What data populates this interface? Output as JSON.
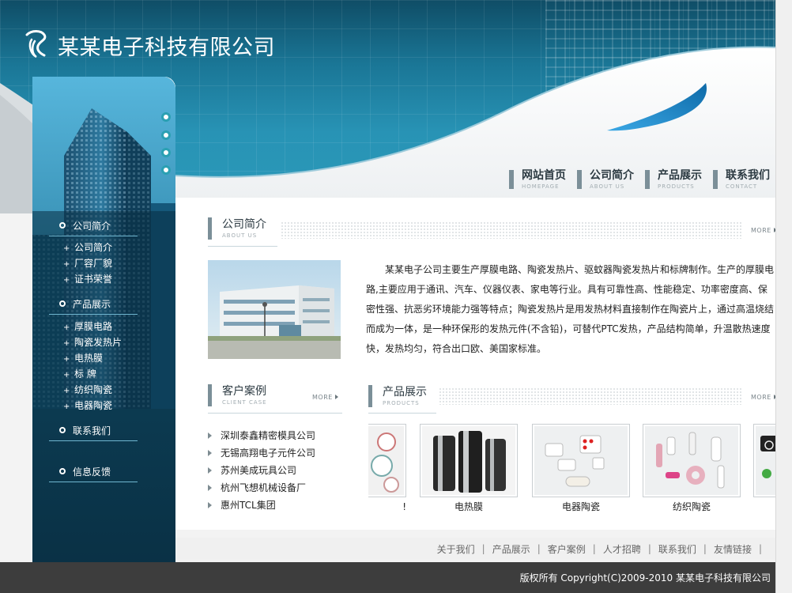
{
  "header": {
    "company_name": "某某电子科技有限公司"
  },
  "nav": [
    {
      "label": "网站首页",
      "sub": "HOMEPAGE"
    },
    {
      "label": "公司简介",
      "sub": "ABOUT US"
    },
    {
      "label": "产品展示",
      "sub": "PRODUCTS"
    },
    {
      "label": "联系我们",
      "sub": "CONTACT"
    }
  ],
  "sidebar": {
    "groups": [
      {
        "title": "公司简介",
        "items": [
          "公司简介",
          "厂容厂貌",
          "证书荣誉"
        ]
      },
      {
        "title": "产品展示",
        "items": [
          "厚膜电路",
          "陶瓷发热片",
          "电热膜",
          "标 牌",
          "纺织陶瓷",
          "电器陶瓷"
        ]
      },
      {
        "title": "联系我们",
        "items": []
      },
      {
        "title": "信息反馈",
        "items": []
      }
    ]
  },
  "about": {
    "title": "公司简介",
    "subtitle": "ABOUT US",
    "more": "MORE",
    "text": "某某电子公司主要生产厚膜电路、陶瓷发热片、驱蚊器陶瓷发热片和标牌制作。生产的厚膜电路,主要应用于通讯、汽车、仪器仪表、家电等行业。具有可靠性高、性能稳定、功率密度高、保密性强、抗恶劣环境能力强等特点；陶瓷发热片是用发热材料直接制作在陶瓷片上，通过高温烧结而成为一体，是一种环保形的发热元件(不含铅)，可替代PTC发热，产品结构简单，升温散热速度快，发热均匀，符合出口欧、美国家标准。"
  },
  "clients": {
    "title": "客户案例",
    "subtitle": "CLIENT CASE",
    "more": "MORE",
    "items": [
      "深圳泰鑫精密模具公司",
      "无锡高翔电子元件公司",
      "苏州美成玩具公司",
      "杭州飞想机械设备厂",
      "惠州TCL集团"
    ]
  },
  "products": {
    "title": "产品展示",
    "subtitle": "PRODUCTS",
    "more": "MORE",
    "items": [
      {
        "label": "!",
        "icon": "ceramic-dials-icon"
      },
      {
        "label": "电热膜",
        "icon": "film-rolls-icon"
      },
      {
        "label": "电器陶瓷",
        "icon": "ceramic-blocks-icon"
      },
      {
        "label": "纺织陶瓷",
        "icon": "ceramic-guides-icon"
      },
      {
        "label": "",
        "icon": "nameplate-icon"
      }
    ]
  },
  "footer": {
    "links": [
      "关于我们",
      "产品展示",
      "客户案例",
      "人才招聘",
      "联系我们",
      "友情链接"
    ],
    "copyright": "版权所有 Copyright(C)2009-2010 某某电子科技有限公司"
  },
  "colors": {
    "banner_dark": "#0f4d66",
    "banner_light": "#2b9ab9",
    "accent_teal": "#2ba0b3",
    "sidebar_dark": "#092f43",
    "footer_bar": "#3d3d3d"
  }
}
